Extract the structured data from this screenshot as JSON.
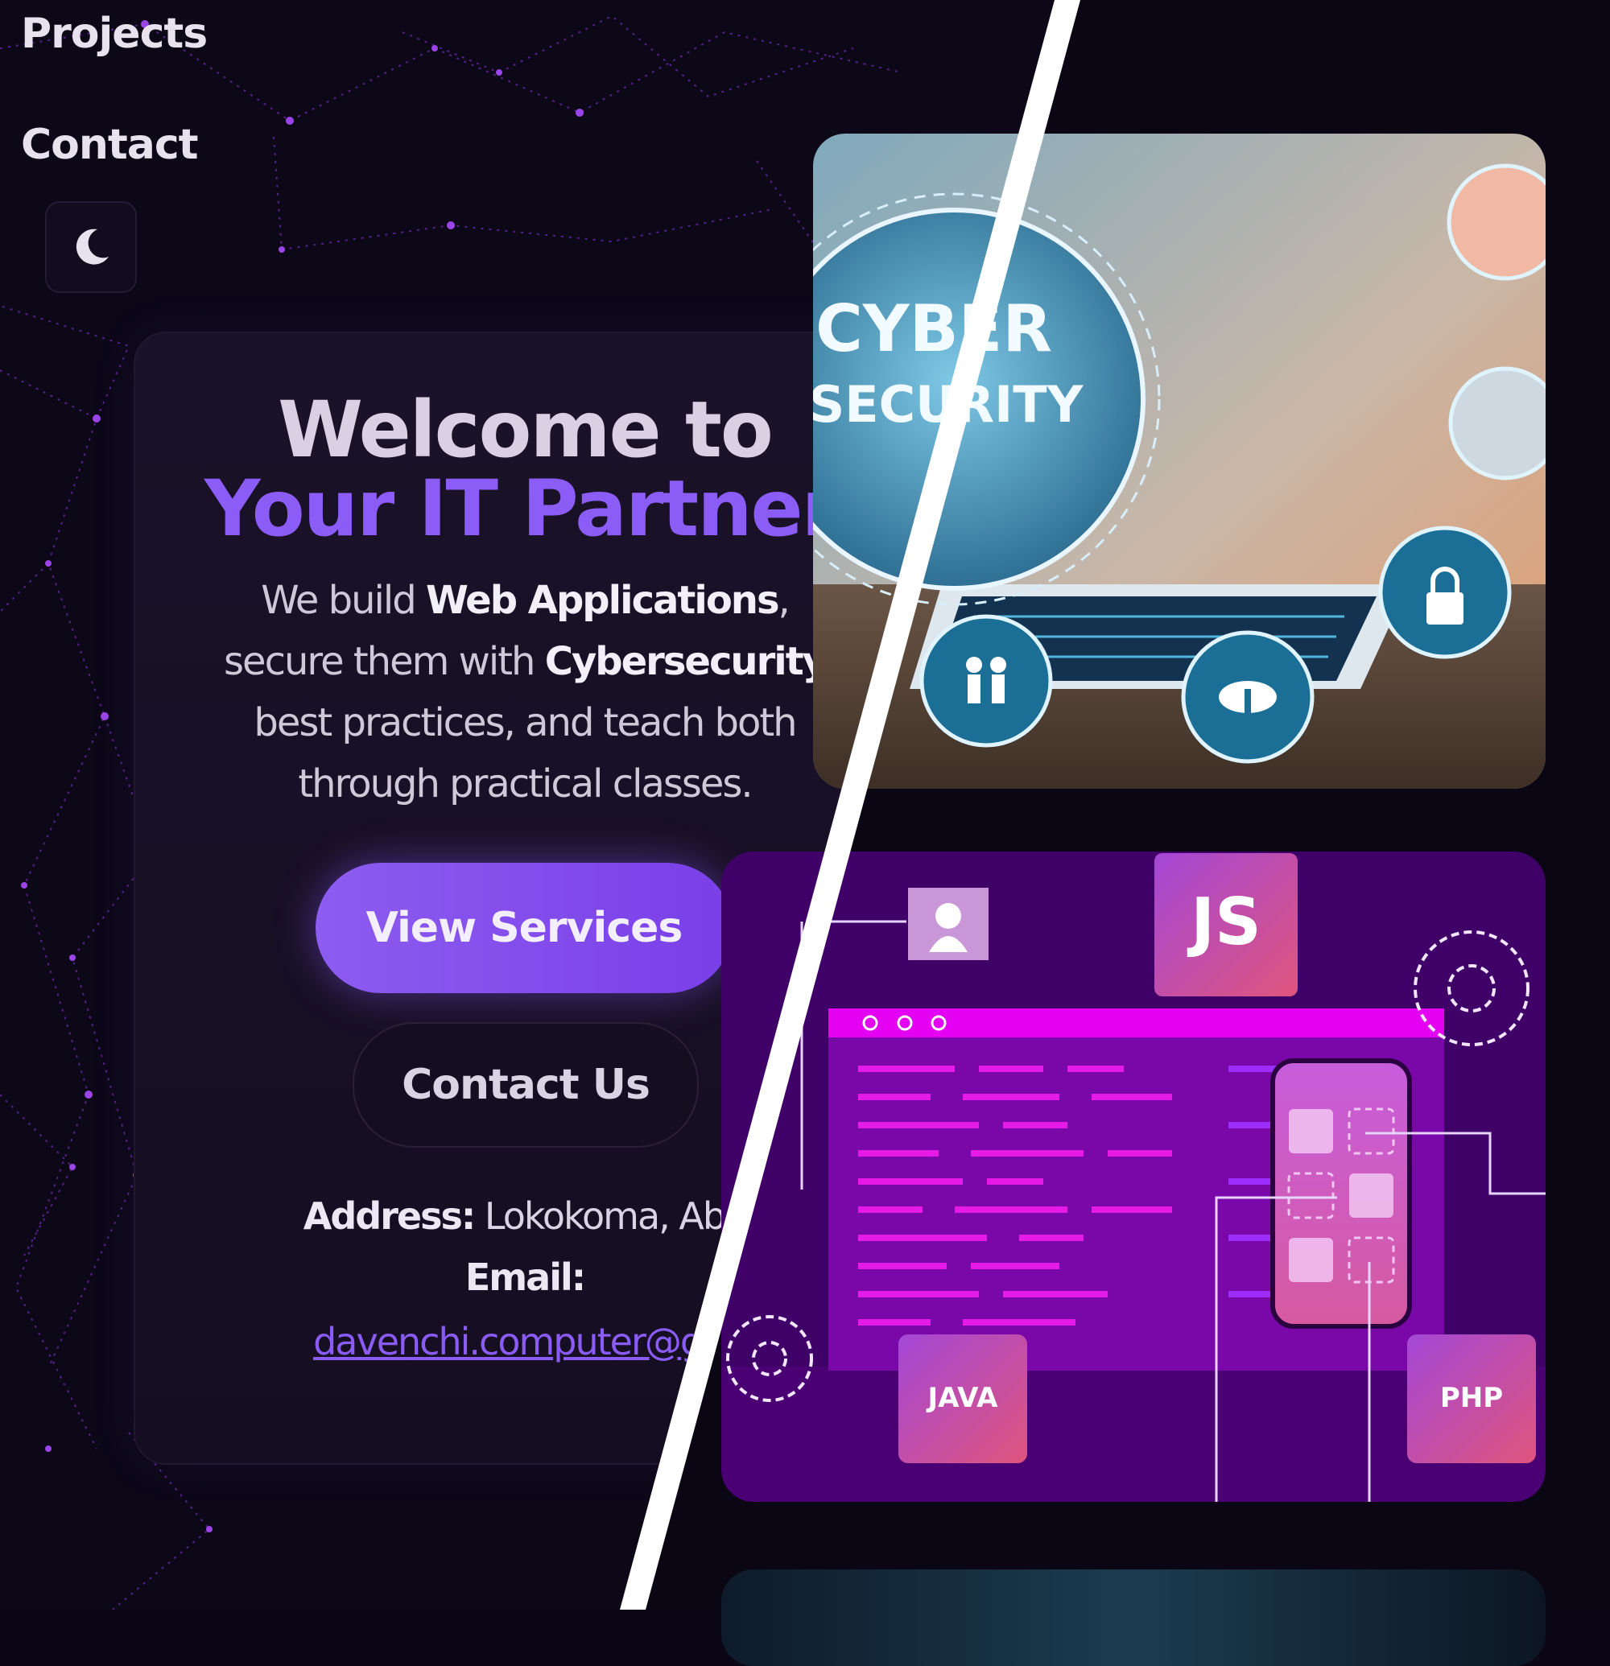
{
  "nav": {
    "projects_label": "Projects",
    "contact_label": "Contact",
    "theme_toggle_icon": "moon-icon"
  },
  "hero": {
    "title_line1": "Welcome to",
    "title_line2": "Your IT Partner",
    "desc": {
      "p1": "We build ",
      "b1": "Web Applications",
      "p2": ",",
      "p3": "secure them with ",
      "b2": "Cybersecurity",
      "p4": "best practices, and teach both",
      "p5": "through practical classes."
    },
    "primary_button": "View Services",
    "secondary_button": "Contact Us",
    "address_label": "Address:",
    "address_value": "Lokokoma, Abu",
    "email_label": "Email:",
    "email_value": "davenchi.computer@gm"
  },
  "images": {
    "cyber": {
      "line1": "CYBER",
      "line2": "SECURITY"
    },
    "dev": {
      "js": "JS",
      "java": "JAVA",
      "php": "PHP"
    }
  },
  "colors": {
    "accent": "#8b5cf6",
    "background": "#0d0818",
    "card": "#181025",
    "divider": "#ffffff"
  }
}
